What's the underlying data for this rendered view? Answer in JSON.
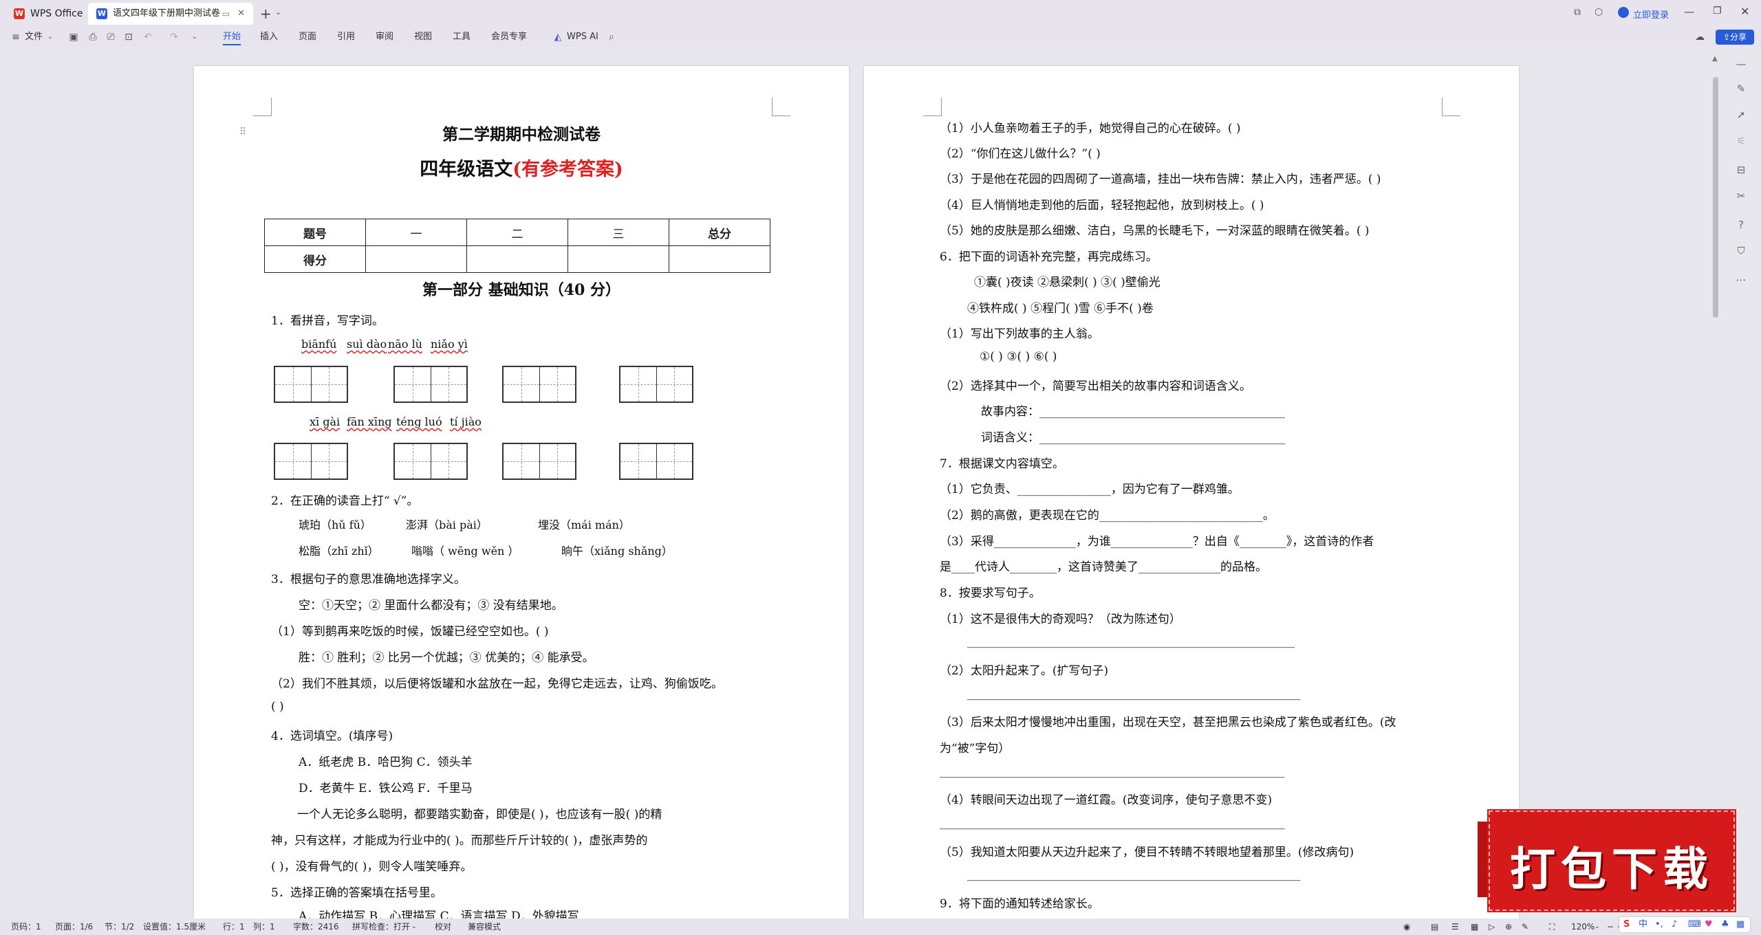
{
  "titlebar": {
    "app_tab": "WPS Office",
    "doc_tab": "语文四年级下册期中测试卷",
    "login_label": "立即登录"
  },
  "toolbar": {
    "file_menu": "文件",
    "tabs": [
      "开始",
      "插入",
      "页面",
      "引用",
      "审阅",
      "视图",
      "工具",
      "会员专享"
    ],
    "ai_label": "WPS AI",
    "share_label": "分享"
  },
  "page1": {
    "title1": "第二学期期中检测试卷",
    "title2_black": "四年级语文",
    "title2_red": "(有参考答案)",
    "score_table": {
      "row1": [
        "题号",
        "一",
        "二",
        "三",
        "总分"
      ],
      "row2": [
        "得分",
        "",
        "",
        "",
        ""
      ]
    },
    "section_heading": "第一部分  基础知识（40 分）",
    "lines": [
      "1．看拼音，写字词。",
      "2．在正确的读音上打“ √”。",
      "3．根据句子的意思准确地选择字义。",
      "空：①天空；② 里面什么都没有；③ 没有结果地。",
      "（1）等到鹅再来吃饭的时候，饭罐已经空空如也。(        )",
      "胜：① 胜利；② 比另一个优越；③ 优美的；④ 能承受。",
      "（2）我们不胜其烦，以后便将饭罐和水盆放在一起，免得它走远去，让鸡、狗偷饭吃。",
      "(        )",
      "4．选词填空。(填序号)",
      "A．纸老虎          B．哈巴狗          C．领头羊",
      "D．老黄牛          E．铁公鸡          F．千里马",
      "一个人无论多么聪明，都要踏实勤奋，即使是(      )，也应该有一股(        )的精",
      "神，只有这样，才能成为行业中的(        )。而那些斤斤计较的(      )，虚张声势的",
      "(        )，没有骨气的(      )，则令人嗤笑唾弃。",
      "5．选择正确的答案填在括号里。",
      "A．动作描写        B．心理描写        C．语言描写        D．外貌描写"
    ],
    "pinyin_row1": [
      "biānfú",
      "suì dào",
      "nāo lù",
      "niǎo yì"
    ],
    "pinyin_row2": [
      "xī gài",
      "fān xīng",
      "téng luó",
      "tí jiào"
    ],
    "reading_row1": [
      "琥珀（hǔ  fǔ）",
      "澎湃（bài  pài）",
      "埋没（mái  mán）"
    ],
    "reading_row2": [
      "松脂（zhī  zhǐ）",
      "嗡嗡（  wēng  wěn  ）",
      "晌午（xiǎng  shǎng）"
    ]
  },
  "page2": {
    "lines": [
      "（1）小人鱼亲吻着王子的手，她觉得自己的心在破碎。(        )",
      "（2）“你们在这儿做什么？”(        )",
      "（3）于是他在花园的四周砌了一道高墙，挂出一块布告牌：禁止入内，违者严惩。(        )",
      "（4）巨人悄悄地走到他的后面，轻轻抱起他，放到树枝上。(        )",
      "（5）她的皮肤是那么细嫩、洁白，乌黑的长睫毛下，一对深蓝的眼睛在微笑着。(        )",
      "6．把下面的词语补充完整，再完成练习。",
      "①囊(      )夜读          ②悬梁刺(      )  ③(      )壁偷光",
      "④铁杵成(      )  ⑤程门(        )雪          ⑥手不(      )卷",
      "（1）写出下列故事的主人翁。",
      "①(            )              ③(            )              ⑥(            )",
      "（2）选择其中一个，简要写出相关的故事内容和词语含义。",
      "故事内容：__________________________________________",
      "词语含义：__________________________________________",
      "7．根据课文内容填空。",
      "（1）它负责、________________，因为它有了一群鸡雏。",
      "（2）鹅的高傲，更表现在它的____________________________。",
      "（3）采得______________，为谁______________？出自《________》，这首诗的作者",
      "是____代诗人________，这首诗赞美了______________的品格。",
      "8．按要求写句子。",
      "（1）这不是很伟大的奇观吗？（改为陈述句）",
      "________________________________________________________",
      "（2）太阳升起来了。(扩写句子)",
      "_________________________________________________________",
      "（3）后来太阳才慢慢地冲出重围，出现在天空，甚至把黑云也染成了紫色或者红色。(改",
      "为“被”字句）",
      "___________________________________________________________",
      "（4）转眼间天边出现了一道红霞。(改变词序，使句子意思不变)",
      "___________________________________________________________",
      "（5）我知道太阳要从天边升起来了，便目不转睛不转眼地望着那里。(修改病句)",
      "_________________________________________________________",
      "9．将下面的通知转述给家长。"
    ]
  },
  "statusbar": {
    "page_num": "页码：1",
    "pages": "页面：1/6",
    "section": "节：1/2",
    "setting": "设置值：1.5厘米",
    "row": "行：1",
    "col": "列：1",
    "words": "字数：2416",
    "spell": "拼写检查：打开",
    "proof": "校对",
    "compat": "兼容模式",
    "zoom": "120%"
  },
  "banner": {
    "text": "打包下载"
  },
  "colors": {
    "accent": "#2a5bd7",
    "red_title": "#e02020",
    "banner_red": "#d41a1a"
  }
}
